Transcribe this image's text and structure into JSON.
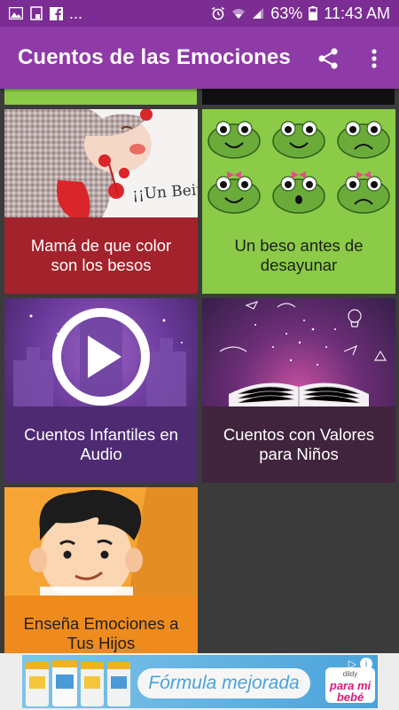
{
  "status_bar": {
    "notification_icons": [
      "image-icon",
      "cast-icon",
      "facebook-icon"
    ],
    "overflow": "...",
    "battery_percent": "63%",
    "time": "11:43 AM",
    "system_icons": [
      "alarm-icon",
      "wifi-icon",
      "signal-icon",
      "battery-icon"
    ]
  },
  "app_bar": {
    "title": "Cuentos de las Emociones",
    "actions": [
      "share-icon",
      "more-vert-icon"
    ],
    "background": "#8e3aa7"
  },
  "cards": [
    {
      "id": "mama-besos",
      "title": "Mamá de que color son los besos",
      "caption_bg": "#a3222b",
      "caption_color": "#ffffff",
      "art_text": "¡¡Un Beito!!"
    },
    {
      "id": "beso-desayunar",
      "title": "Un beso antes de desayunar",
      "caption_bg": "#8bcb47",
      "caption_color": "#1f1f1f"
    },
    {
      "id": "cuentos-audio",
      "title": "Cuentos Infantiles en Audio",
      "caption_bg": "#4e2a72",
      "caption_color": "#ffffff"
    },
    {
      "id": "cuentos-valores",
      "title": "Cuentos con Valores para Niños",
      "caption_bg": "#40243d",
      "caption_color": "#ffffff"
    },
    {
      "id": "ensena-emociones",
      "title": "Enseña Emociones a Tus Hijos",
      "caption_bg": "#ef8b1d",
      "caption_color": "#1f1f1f"
    }
  ],
  "ad": {
    "headline": "Fórmula mejorada",
    "brand_top": "dildy",
    "brand_line1": "para mi",
    "brand_line2": "bebé"
  }
}
